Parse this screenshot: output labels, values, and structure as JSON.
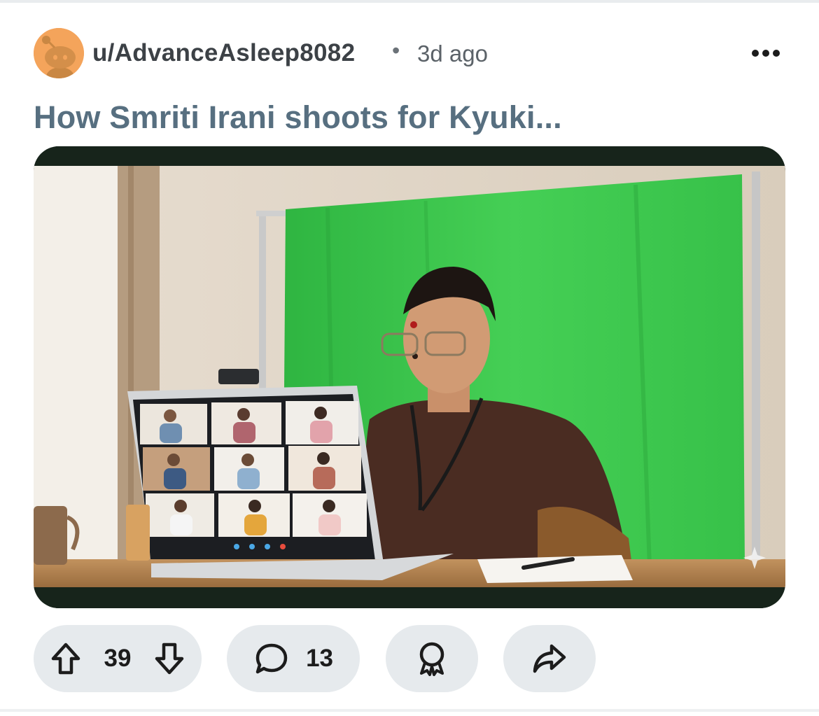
{
  "post": {
    "author": "u/AdvanceAsleep8082",
    "separator": "•",
    "time_ago": "3d ago",
    "title": "How Smriti Irani shoots for Kyuki..."
  },
  "actions": {
    "upvotes": "39",
    "comments": "13"
  },
  "icons": {
    "more": "more-horizontal-icon",
    "upvote": "arrow-up-icon",
    "downvote": "arrow-down-icon",
    "comment": "speech-bubble-icon",
    "award": "award-ribbon-icon",
    "share": "share-arrow-icon"
  },
  "colors": {
    "avatar": "#f4a45b",
    "title": "#576f80",
    "pill": "#e6eaed",
    "green_screen": "#3ec94f"
  }
}
